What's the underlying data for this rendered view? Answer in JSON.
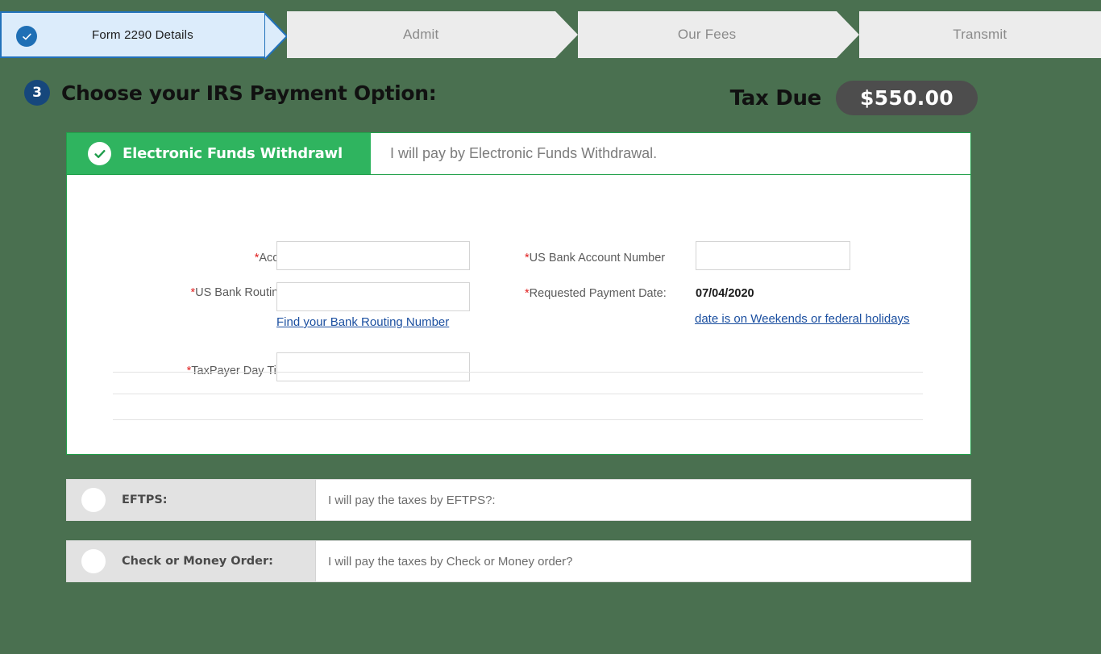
{
  "stepper": {
    "steps": [
      {
        "label": "Form 2290 Details",
        "state": "active",
        "icon": "check-circle-icon"
      },
      {
        "label": "Admit",
        "state": "inactive"
      },
      {
        "label": "Our Fees",
        "state": "inactive"
      },
      {
        "label": "Transmit",
        "state": "inactive"
      }
    ]
  },
  "section": {
    "number": "3",
    "title": "Choose your IRS Payment Option:"
  },
  "tax_due": {
    "label": "Tax Due",
    "amount": "$550.00"
  },
  "efw": {
    "selected": true,
    "title": "Electronic Funds Withdrawl",
    "description": "I will pay by Electronic Funds Withdrawal.",
    "fields": {
      "account_type": {
        "label": "Account Type:",
        "required": true,
        "value": ""
      },
      "routing_number": {
        "label": "US Bank Routing Number:",
        "required": true,
        "value": ""
      },
      "routing_link": "Find your Bank Routing Number",
      "phone": {
        "label": "TaxPayer Day Time Phone:",
        "required": true,
        "value": ""
      },
      "account_number": {
        "label": "US Bank Account Number",
        "required": true,
        "value": ""
      },
      "payment_date": {
        "label": "Requested Payment Date:",
        "required": true,
        "value": "07/04/2020"
      },
      "payment_date_note": "date is on Weekends or federal holidays"
    }
  },
  "options": [
    {
      "name": "EFTPS:",
      "description": "I will pay the taxes by EFTPS?:",
      "selected": false
    },
    {
      "name": "Check or Money Order:",
      "description": "I will pay the taxes by Check or Money order?",
      "selected": false
    }
  ],
  "colors": {
    "background": "#4a7050",
    "accent_green": "#2fb45f",
    "accent_blue": "#1f6fb5",
    "badge_navy": "#16477c",
    "pill_gray": "#4d4d4d",
    "required_red": "#e02020",
    "link_blue": "#1b4fa0"
  }
}
